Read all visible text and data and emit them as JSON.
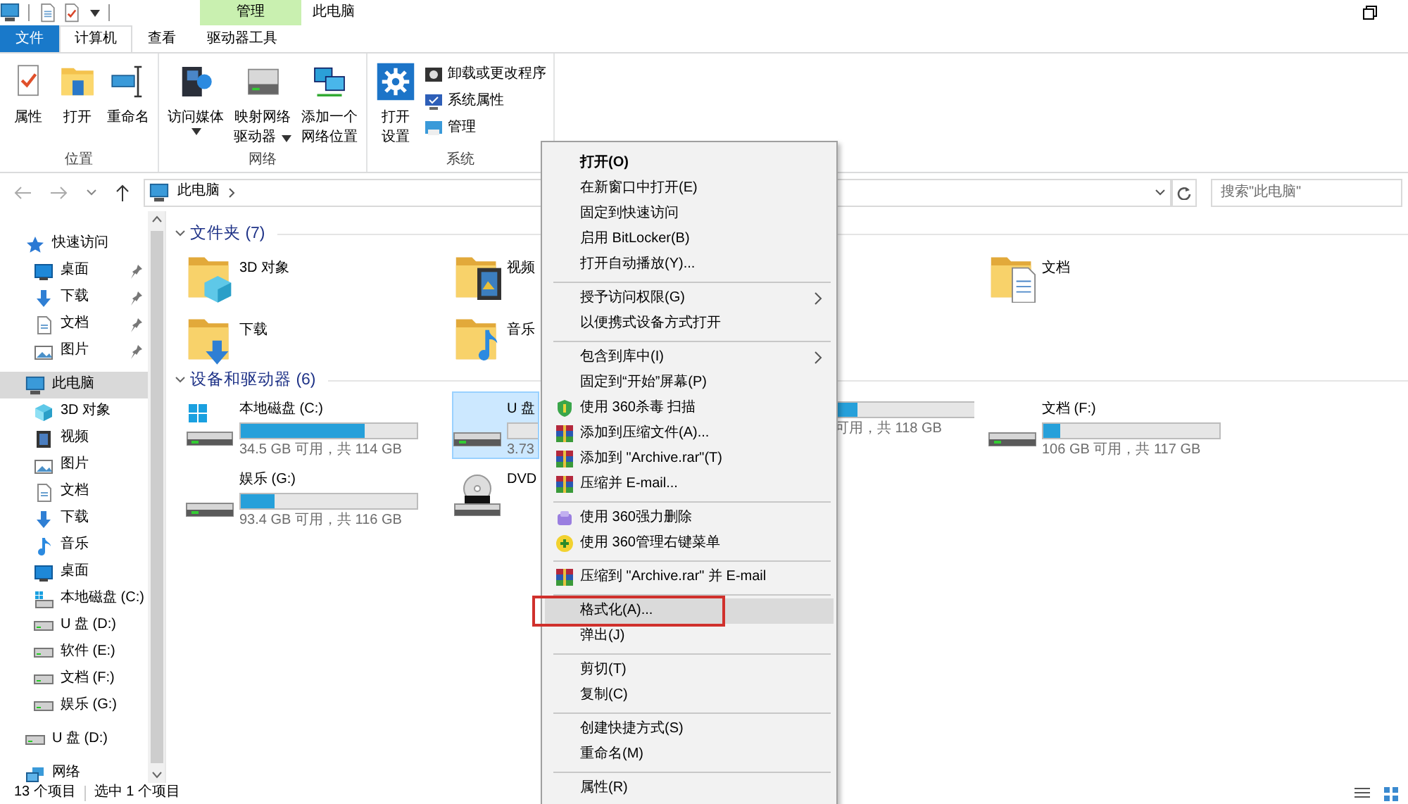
{
  "title_bar": {
    "context_tab": "管理",
    "title": "此电脑"
  },
  "ribbon_tabs": [
    {
      "label": "文件",
      "kind": "file",
      "selected": false
    },
    {
      "label": "计算机",
      "kind": "tab",
      "selected": true
    },
    {
      "label": "查看",
      "kind": "tab",
      "selected": false
    },
    {
      "label": "驱动器工具",
      "kind": "tab",
      "selected": false
    }
  ],
  "ribbon_groups": [
    {
      "label": "位置",
      "commands": [
        {
          "kind": "large",
          "lines": [
            "属性"
          ]
        },
        {
          "kind": "large",
          "lines": [
            "打开"
          ]
        },
        {
          "kind": "large",
          "lines": [
            "重命名"
          ]
        }
      ]
    },
    {
      "label": "网络",
      "commands": [
        {
          "kind": "large",
          "lines": [
            "访问媒体"
          ],
          "dropdown": true
        },
        {
          "kind": "large",
          "lines": [
            "映射网络",
            "驱动器"
          ],
          "dropdown": true
        },
        {
          "kind": "large",
          "lines": [
            "添加一个",
            "网络位置"
          ]
        }
      ]
    },
    {
      "label": "系统",
      "commands": [
        {
          "kind": "large",
          "lines": [
            "打开",
            "设置"
          ]
        },
        {
          "kind": "small",
          "lines": [
            "卸载或更改程序"
          ]
        },
        {
          "kind": "small",
          "lines": [
            "系统属性"
          ]
        },
        {
          "kind": "small",
          "lines": [
            "管理"
          ]
        }
      ]
    }
  ],
  "address": {
    "location": "此电脑",
    "search_placeholder": "搜索\"此电脑\""
  },
  "sidebar": {
    "items": [
      {
        "label": "快速访问",
        "selected": false,
        "children": [
          {
            "label": "桌面",
            "selected": false,
            "pinned": true
          },
          {
            "label": "下载",
            "selected": false,
            "pinned": true
          },
          {
            "label": "文档",
            "selected": false,
            "pinned": true
          },
          {
            "label": "图片",
            "selected": false,
            "pinned": true
          }
        ]
      },
      {
        "label": "此电脑",
        "selected": true,
        "children": [
          {
            "label": "3D 对象",
            "selected": false
          },
          {
            "label": "视频",
            "selected": false
          },
          {
            "label": "图片",
            "selected": false
          },
          {
            "label": "文档",
            "selected": false
          },
          {
            "label": "下载",
            "selected": false
          },
          {
            "label": "音乐",
            "selected": false
          },
          {
            "label": "桌面",
            "selected": false
          },
          {
            "label": "本地磁盘 (C:)",
            "selected": false
          },
          {
            "label": "U 盘 (D:)",
            "selected": false
          },
          {
            "label": "软件 (E:)",
            "selected": false
          },
          {
            "label": "文档 (F:)",
            "selected": false
          },
          {
            "label": "娱乐 (G:)",
            "selected": false
          }
        ]
      },
      {
        "label": "U 盘 (D:)",
        "selected": false
      },
      {
        "label": "网络",
        "selected": false
      }
    ]
  },
  "content": {
    "sections": [
      {
        "title": "文件夹 (7)",
        "expanded": true,
        "rows": [
          [
            {
              "kind": "folder",
              "name": "3D 对象"
            },
            {
              "kind": "folder",
              "name": "视频"
            },
            {
              "kind": "folder",
              "name": "文档"
            }
          ],
          [
            {
              "kind": "folder",
              "name": "下载"
            },
            {
              "kind": "folder",
              "name": "音乐"
            }
          ]
        ]
      },
      {
        "title": "设备和驱动器 (6)",
        "expanded": true,
        "rows": [
          [
            {
              "kind": "system-drive",
              "name": "本地磁盘 (C:)",
              "usage": "34.5 GB 可用，共 114 GB",
              "level": 0.7,
              "selected": false
            },
            {
              "kind": "drive",
              "name": "U 盘",
              "usage": "3.73",
              "selected": true
            },
            {
              "kind": "drive-tail",
              "usage": "可用，共 118 GB",
              "level": 0.33,
              "selected": false
            },
            {
              "kind": "drive",
              "name": "文档 (F:)",
              "usage": "106 GB 可用，共 117 GB",
              "level": 0.094,
              "selected": false
            }
          ],
          [
            {
              "kind": "drive",
              "name": "娱乐 (G:)",
              "usage": "93.4 GB 可用，共 116 GB",
              "level": 0.195,
              "selected": false
            },
            {
              "kind": "dvd",
              "name": "DVD",
              "selected": false
            }
          ]
        ]
      }
    ]
  },
  "context_menu": {
    "items": [
      {
        "kind": "item",
        "label": "打开(O)",
        "default": true
      },
      {
        "kind": "item",
        "label": "在新窗口中打开(E)"
      },
      {
        "kind": "item",
        "label": "固定到快速访问"
      },
      {
        "kind": "item",
        "label": "启用 BitLocker(B)"
      },
      {
        "kind": "item",
        "label": "打开自动播放(Y)..."
      },
      {
        "kind": "separator"
      },
      {
        "kind": "item",
        "label": "授予访问权限(G)",
        "submenu": true
      },
      {
        "kind": "item",
        "label": "以便携式设备方式打开"
      },
      {
        "kind": "separator"
      },
      {
        "kind": "item",
        "label": "包含到库中(I)",
        "submenu": true
      },
      {
        "kind": "item",
        "label": "固定到“开始”屏幕(P)"
      },
      {
        "kind": "item",
        "label": "使用 360杀毒 扫描"
      },
      {
        "kind": "item",
        "label": "添加到压缩文件(A)..."
      },
      {
        "kind": "item",
        "label": "添加到 \"Archive.rar\"(T)"
      },
      {
        "kind": "item",
        "label": "压缩并 E-mail..."
      },
      {
        "kind": "separator"
      },
      {
        "kind": "item",
        "label": "使用 360强力删除"
      },
      {
        "kind": "item",
        "label": "使用 360管理右键菜单"
      },
      {
        "kind": "separator"
      },
      {
        "kind": "item",
        "label": "压缩到 \"Archive.rar\" 并 E-mail"
      },
      {
        "kind": "separator"
      },
      {
        "kind": "item",
        "label": "格式化(A)...",
        "highlighted": true,
        "outlined": true
      },
      {
        "kind": "item",
        "label": "弹出(J)"
      },
      {
        "kind": "separator"
      },
      {
        "kind": "item",
        "label": "剪切(T)"
      },
      {
        "kind": "item",
        "label": "复制(C)"
      },
      {
        "kind": "separator"
      },
      {
        "kind": "item",
        "label": "创建快捷方式(S)"
      },
      {
        "kind": "item",
        "label": "重命名(M)"
      },
      {
        "kind": "separator"
      },
      {
        "kind": "item",
        "label": "属性(R)"
      }
    ]
  },
  "status_bar": {
    "item_count": "13 个项目",
    "selection": "选中 1 个项目"
  }
}
